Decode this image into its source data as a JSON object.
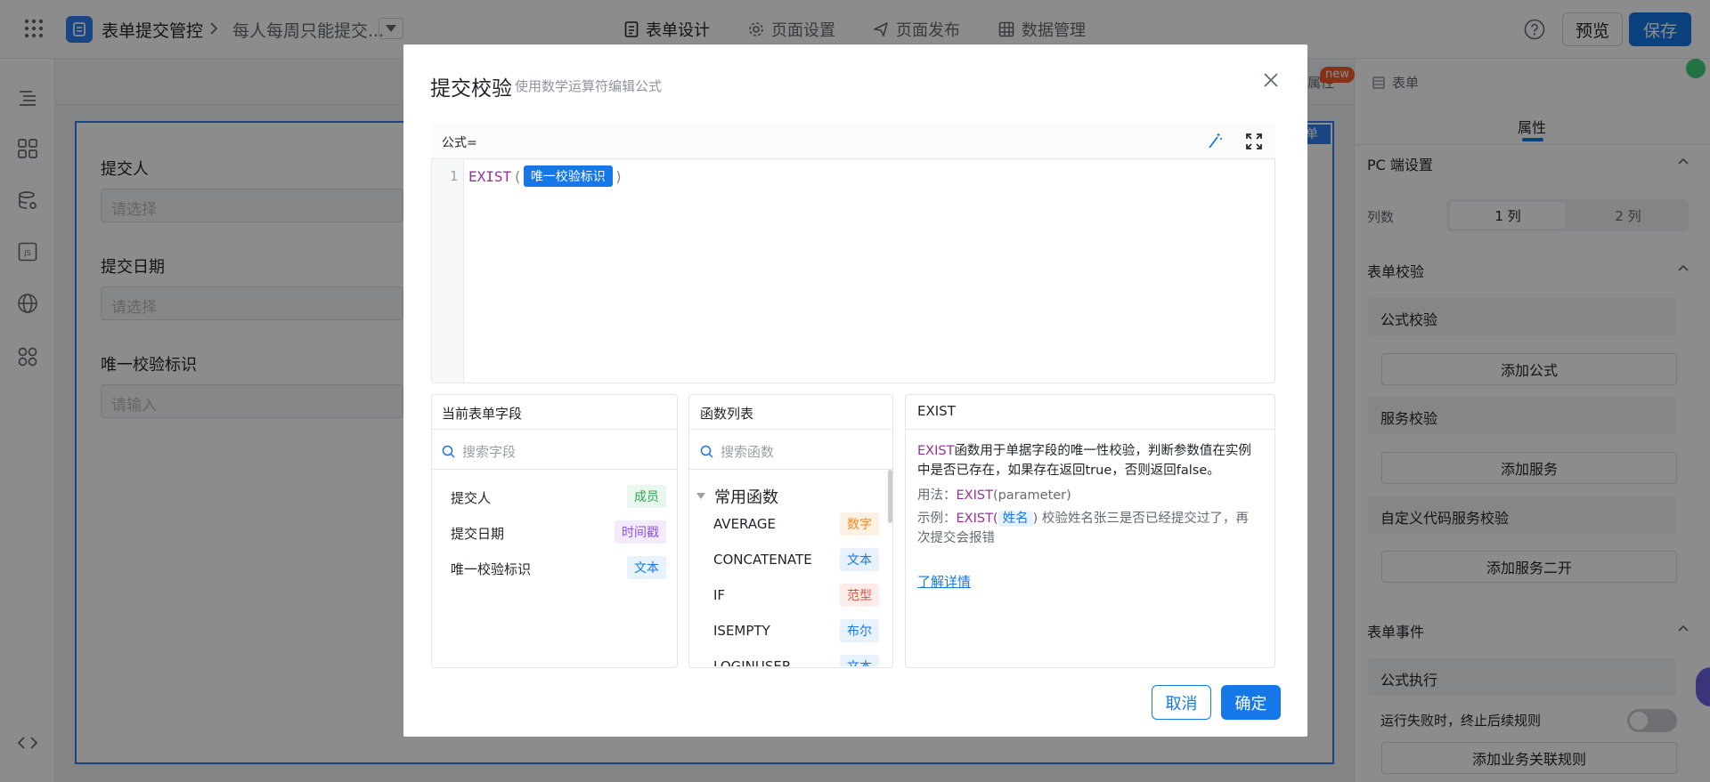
{
  "header": {
    "app_title": "表单提交管控",
    "breadcrumb_current": "每人每周只能提交...",
    "tabs": [
      {
        "label": "表单设计",
        "active": true
      },
      {
        "label": "页面设置",
        "active": false
      },
      {
        "label": "页面发布",
        "active": false
      },
      {
        "label": "数据管理",
        "active": false
      }
    ],
    "preview_label": "预览",
    "save_label": "保存"
  },
  "canvas": {
    "fields": [
      {
        "label": "提交人",
        "placeholder": "请选择"
      },
      {
        "label": "提交日期",
        "placeholder": "请选择"
      },
      {
        "label": "唯一校验标识",
        "placeholder": "请输入"
      }
    ],
    "form_tag": "单",
    "attr_tab": "属性",
    "new_badge": "new",
    "form_tab": "表单"
  },
  "right_panel": {
    "tab": "属性",
    "pc_section": "PC 端设置",
    "columns_label": "列数",
    "columns_options": [
      "1 列",
      "2 列"
    ],
    "columns_selected": "1 列",
    "validation_section": "表单校验",
    "formula_validation": "公式校验",
    "add_formula": "添加公式",
    "service_validation": "服务校验",
    "add_service": "添加服务",
    "custom_validation": "自定义代码服务校验",
    "add_service_dev": "添加服务二开",
    "events_section": "表单事件",
    "formula_exec": "公式执行",
    "fail_stop_label": "运行失败时，终止后续规则",
    "add_rule": "添加业务关联规则"
  },
  "modal": {
    "title": "提交校验",
    "subtitle": "使用数学运算符编辑公式",
    "formula_label": "公式=",
    "line_number": "1",
    "code": {
      "func": "EXIST",
      "open": "(",
      "chip": "唯一校验标识",
      "close": ")"
    },
    "fields_pane": {
      "title": "当前表单字段",
      "search_placeholder": "搜索字段",
      "items": [
        {
          "label": "提交人",
          "tag": "成员"
        },
        {
          "label": "提交日期",
          "tag": "时间戳"
        },
        {
          "label": "唯一校验标识",
          "tag": "文本"
        }
      ]
    },
    "func_pane": {
      "title": "函数列表",
      "search_placeholder": "搜索函数",
      "group": "常用函数",
      "items": [
        {
          "label": "AVERAGE",
          "tag": "数字"
        },
        {
          "label": "CONCATENATE",
          "tag": "文本"
        },
        {
          "label": "IF",
          "tag": "范型"
        },
        {
          "label": "ISEMPTY",
          "tag": "布尔"
        },
        {
          "label": "LOGINUSER",
          "tag": "文本"
        }
      ]
    },
    "doc_pane": {
      "title": "EXIST",
      "desc_func": "EXIST",
      "desc_line1": "函数用于单据字段的唯一性校验，判断参数值在实例",
      "desc_line2": "中是否已存在，如果存在返回true，否则返回false。",
      "usage_label": "用法：",
      "usage_func": "EXIST",
      "usage_rest": "(parameter)",
      "example_label": "示例：",
      "example_func": "EXIST(",
      "example_chip": "姓名",
      "example_rest1": ")  校验姓名张三是否已经提交过了，再",
      "example_rest2": "次提交会报错",
      "learn_more": "了解详情"
    },
    "cancel_label": "取消",
    "ok_label": "确定"
  },
  "colors": {
    "primary": "#1677e8",
    "func_purple": "#9c2f9b",
    "tag_member": "#2ea44f",
    "tag_time": "#8a54d8",
    "tag_text": "#1677e8",
    "tag_number": "#f08a24",
    "tag_generic": "#e0553a"
  }
}
